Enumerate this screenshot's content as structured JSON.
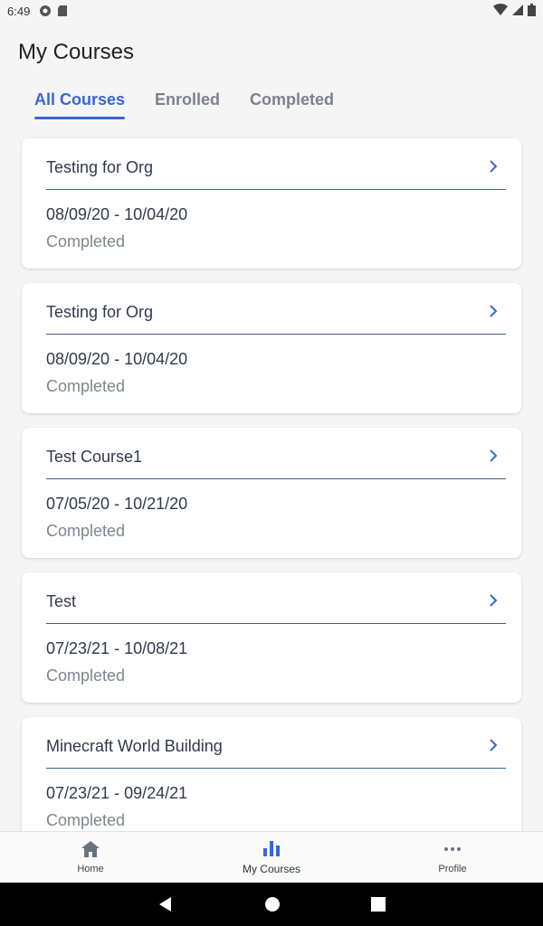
{
  "status_bar": {
    "time": "6:49"
  },
  "header": {
    "title": "My Courses"
  },
  "tabs": [
    {
      "label": "All Courses",
      "active": true
    },
    {
      "label": "Enrolled",
      "active": false
    },
    {
      "label": "Completed",
      "active": false
    }
  ],
  "courses": [
    {
      "title": "Testing for Org",
      "dates": "08/09/20 - 10/04/20",
      "status": "Completed"
    },
    {
      "title": "Testing for Org",
      "dates": "08/09/20 - 10/04/20",
      "status": "Completed"
    },
    {
      "title": "Test Course1",
      "dates": "07/05/20 - 10/21/20",
      "status": "Completed"
    },
    {
      "title": "Test",
      "dates": "07/23/21 - 10/08/21",
      "status": "Completed"
    },
    {
      "title": "Minecraft World Building",
      "dates": "07/23/21 - 09/24/21",
      "status": "Completed"
    }
  ],
  "bottom_nav": [
    {
      "label": "Home",
      "icon": "home-icon"
    },
    {
      "label": "My Courses",
      "icon": "bar-chart-icon",
      "active": true
    },
    {
      "label": "Profile",
      "icon": "more-horizontal-icon"
    }
  ],
  "colors": {
    "accent": "#3a66d6",
    "divider": "#3d5f8f",
    "muted_text": "#7f8591",
    "background": "#f5f5f5"
  }
}
